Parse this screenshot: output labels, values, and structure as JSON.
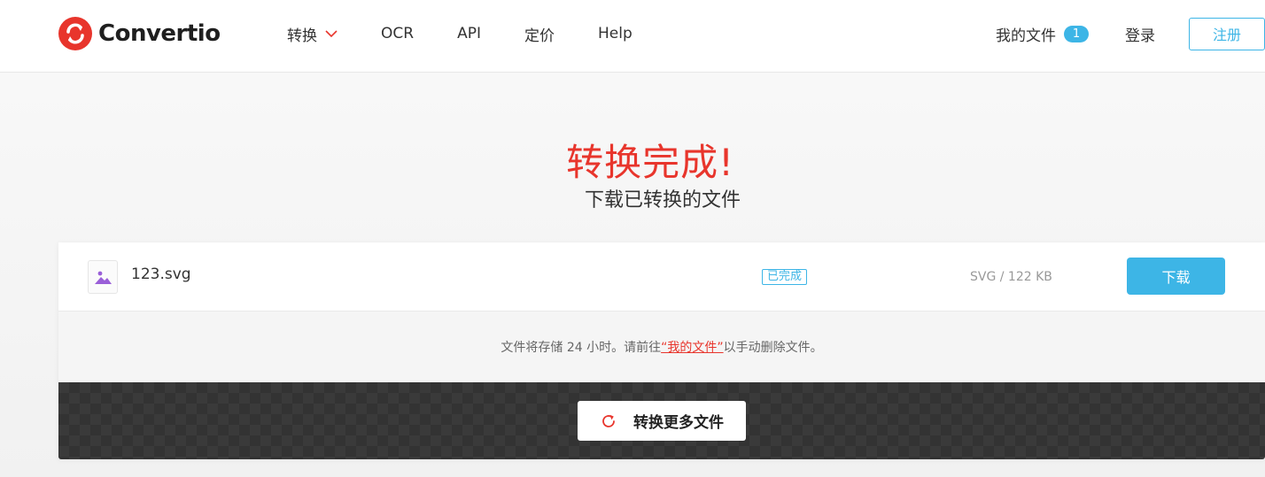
{
  "brand": {
    "name": "Convertio",
    "logo_icon": "convertio-logo-icon",
    "color": "#e8352c"
  },
  "nav": {
    "items": [
      {
        "label": "转换",
        "has_dropdown": true,
        "icon": "chevron-down-icon"
      },
      {
        "label": "OCR"
      },
      {
        "label": "API"
      },
      {
        "label": "定价"
      },
      {
        "label": "Help"
      }
    ]
  },
  "header_right": {
    "my_files_label": "我的文件",
    "my_files_count": "1",
    "login_label": "登录",
    "signup_label": "注册"
  },
  "hero": {
    "title": "转换完成!",
    "subtitle": "下载已转换的文件"
  },
  "file": {
    "icon": "image-icon",
    "name": "123.svg",
    "status": "已完成",
    "info": "SVG / 122 KB",
    "download_label": "下载"
  },
  "note": {
    "prefix": "文件将存储 24 小时。请前往",
    "link": "“我的文件”",
    "suffix": "以手动删除文件。"
  },
  "actions": {
    "convert_more_label": "转换更多文件",
    "convert_more_icon": "refresh-icon"
  },
  "colors": {
    "accent_blue": "#3db5e6",
    "title_red": "#e8352c"
  }
}
